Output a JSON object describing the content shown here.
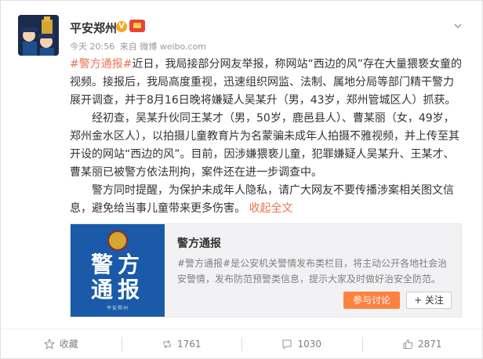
{
  "post": {
    "author": "平安郑州",
    "verified_badge": "V",
    "meta_time": "今天 20:56",
    "meta_from": "来自 微博 weibo.com",
    "hashtag": "#警方通报#",
    "paragraph1_text": "近日，我局接部分网友举报，称网站“西边的风”存在大量猥亵女童的视频。接报后，我局高度重视，迅速组织网监、法制、属地分局等部门精干警力展开调查，并于8月16日晚将嫌疑人吴某升（男，43岁，郑州管城区人）抓获。",
    "paragraph2": "经初查，吴某升伙同王某才（男，50岁，鹿邑县人）、曹某丽（女，49岁，郑州金水区人），以拍摄儿童教育片为名蒙骗未成年人拍摄不雅视频，并上传至其开设的网站“西边的风”。目前，因涉嫌猥亵儿童，犯罪嫌疑人吴某升、王某才、曹某丽已被警方依法刑拘，案件还在进一步调查中。",
    "paragraph3_text": "警方同时提醒，为保护未成年人隐私，请广大网友不要传播涉案相关图文信息，避免给当事儿童带来更多伤害。",
    "collapse_link": "收起全文"
  },
  "share_card": {
    "thumb_line1": "警方",
    "thumb_line2": "通报",
    "thumb_footer": "平安郑州",
    "title": "警方通报",
    "description": "#警方通报#是公安机关警情发布类栏目，将主动公开各地社会治安警情，发布防范预警类信息，提示大家及时做好治安全防范。",
    "discuss_button": "参与讨论",
    "follow_button": "+ 关注"
  },
  "actions": {
    "favorite": "收藏",
    "repost": "1761",
    "comment": "1030",
    "like": "2871"
  },
  "colors": {
    "accent": "#eb7350",
    "discuss_bg": "#ff8140",
    "thumb_bg": "#1a5aa8"
  },
  "icons": {
    "chevron": "chevron-down-icon",
    "favorite": "star-icon",
    "repost": "repost-icon",
    "comment": "comment-icon",
    "like": "thumbs-up-icon"
  }
}
